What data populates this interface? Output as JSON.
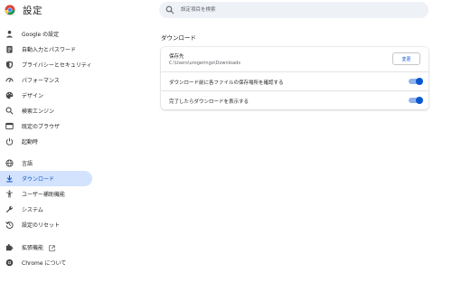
{
  "header": {
    "title": "設定",
    "search_placeholder": "設定項目を検索"
  },
  "sidebar": {
    "items": [
      {
        "label": "Google の設定",
        "icon": "person-icon"
      },
      {
        "label": "自動入力とパスワード",
        "icon": "clipboard-icon"
      },
      {
        "label": "プライバシーとセキュリティ",
        "icon": "shield-icon"
      },
      {
        "label": "パフォーマンス",
        "icon": "speedometer-icon"
      },
      {
        "label": "デザイン",
        "icon": "palette-icon"
      },
      {
        "label": "検索エンジン",
        "icon": "search-icon"
      },
      {
        "label": "既定のブラウザ",
        "icon": "browser-icon"
      },
      {
        "label": "起動時",
        "icon": "power-icon"
      },
      {
        "label": "言語",
        "icon": "globe-icon"
      },
      {
        "label": "ダウンロード",
        "icon": "download-icon"
      },
      {
        "label": "ユーザー補助機能",
        "icon": "accessibility-icon"
      },
      {
        "label": "システム",
        "icon": "wrench-icon"
      },
      {
        "label": "設定のリセット",
        "icon": "reset-icon"
      },
      {
        "label": "拡張機能",
        "icon": "puzzle-icon"
      },
      {
        "label": "Chrome について",
        "icon": "chrome-icon"
      }
    ],
    "active_item": "ダウンロード"
  },
  "main": {
    "section_title": "ダウンロード",
    "location_label": "保存先",
    "location_path": "C:\\Users\\urogeringo\\Downloads",
    "change_button": "変更",
    "settings": [
      {
        "label": "ダウンロード前に各ファイルの保存場所を確認する",
        "enabled": true
      },
      {
        "label": "完了したらダウンロードを表示する",
        "enabled": true
      }
    ]
  },
  "colors": {
    "accent": "#0b57d0",
    "active_nav_bg": "#d3e3fd",
    "search_bg": "#eef1f6"
  }
}
